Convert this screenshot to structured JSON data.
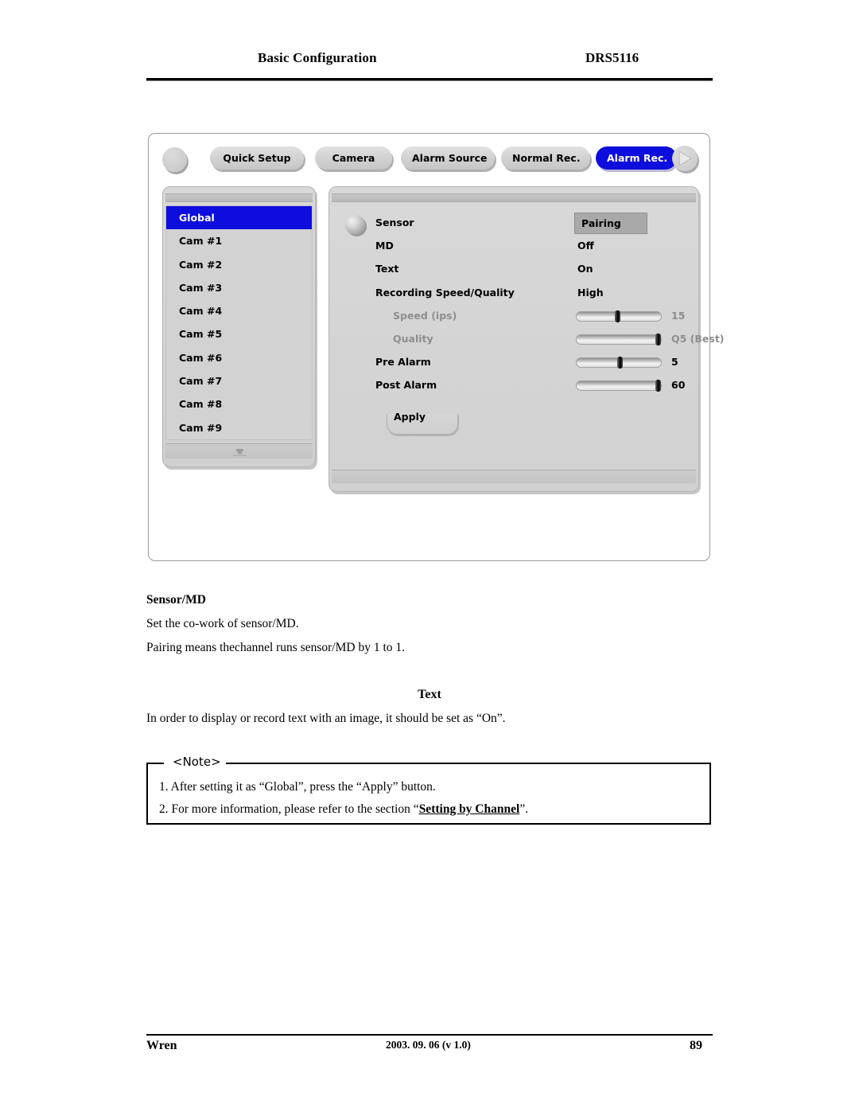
{
  "page": {
    "header_title": "Basic Configuration",
    "header_model": "DRS5116"
  },
  "dvr": {
    "tabs": [
      {
        "label": "Quick Setup",
        "active": false
      },
      {
        "label": "Camera",
        "active": false
      },
      {
        "label": "Alarm Source",
        "active": false
      },
      {
        "label": "Normal Rec.",
        "active": false
      },
      {
        "label": "Alarm Rec.",
        "active": true
      }
    ],
    "next_icon": "right-arrow-icon",
    "home_icon": "circle-button-icon",
    "camera_list": {
      "items": [
        "Global",
        "Cam #1",
        "Cam #2",
        "Cam #3",
        "Cam #4",
        "Cam #5",
        "Cam #6",
        "Cam #7",
        "Cam #8",
        "Cam #9"
      ],
      "selected": "Global",
      "scroll_icon": "scroll-down-icon"
    },
    "settings": {
      "knob_icon": "dial-knob-icon",
      "rows": [
        {
          "label": "Sensor",
          "value": "Pairing",
          "style": "boxed"
        },
        {
          "label": "MD",
          "value": "Off",
          "style": "text"
        },
        {
          "label": "Text",
          "value": "On",
          "style": "text"
        },
        {
          "label": "Recording Speed/Quality",
          "value": "High",
          "style": "text"
        },
        {
          "label": "Speed (ips)",
          "value": "15",
          "style": "slider",
          "dim": true,
          "pct": 45
        },
        {
          "label": "Quality",
          "value": "Q5 (Best)",
          "style": "slider",
          "dim": true,
          "pct": 93
        },
        {
          "label": "Pre Alarm",
          "value": "5",
          "style": "slider",
          "dim": false,
          "pct": 48
        },
        {
          "label": "Post Alarm",
          "value": "60",
          "style": "slider",
          "dim": false,
          "pct": 93
        }
      ],
      "apply_label": "Apply"
    },
    "colors": {
      "accent_blue": "#0d0ddd",
      "panel_gray": "#d4d4d4",
      "highlight_gray": "#a9a9a9"
    }
  },
  "content": {
    "section1_heading": "Sensor/MD",
    "section1_p1": "Set the co-work of sensor/MD.",
    "section1_p2": "Pairing means thechannel runs sensor/MD by 1 to 1.",
    "section2_heading": "Text",
    "section2_p1": "In order to display or record text with an image, it should be set as “On”."
  },
  "note": {
    "legend": "<Note>",
    "line1": "1. After setting it as “Global”, press the “Apply” button.",
    "line2_prefix": "2. For more information, please refer to the section “",
    "line2_bold": "Setting by Channel",
    "line2_suffix": "”."
  },
  "footer": {
    "left": "Wren",
    "center": "2003. 09. 06 (v 1.0)",
    "right": "89"
  }
}
